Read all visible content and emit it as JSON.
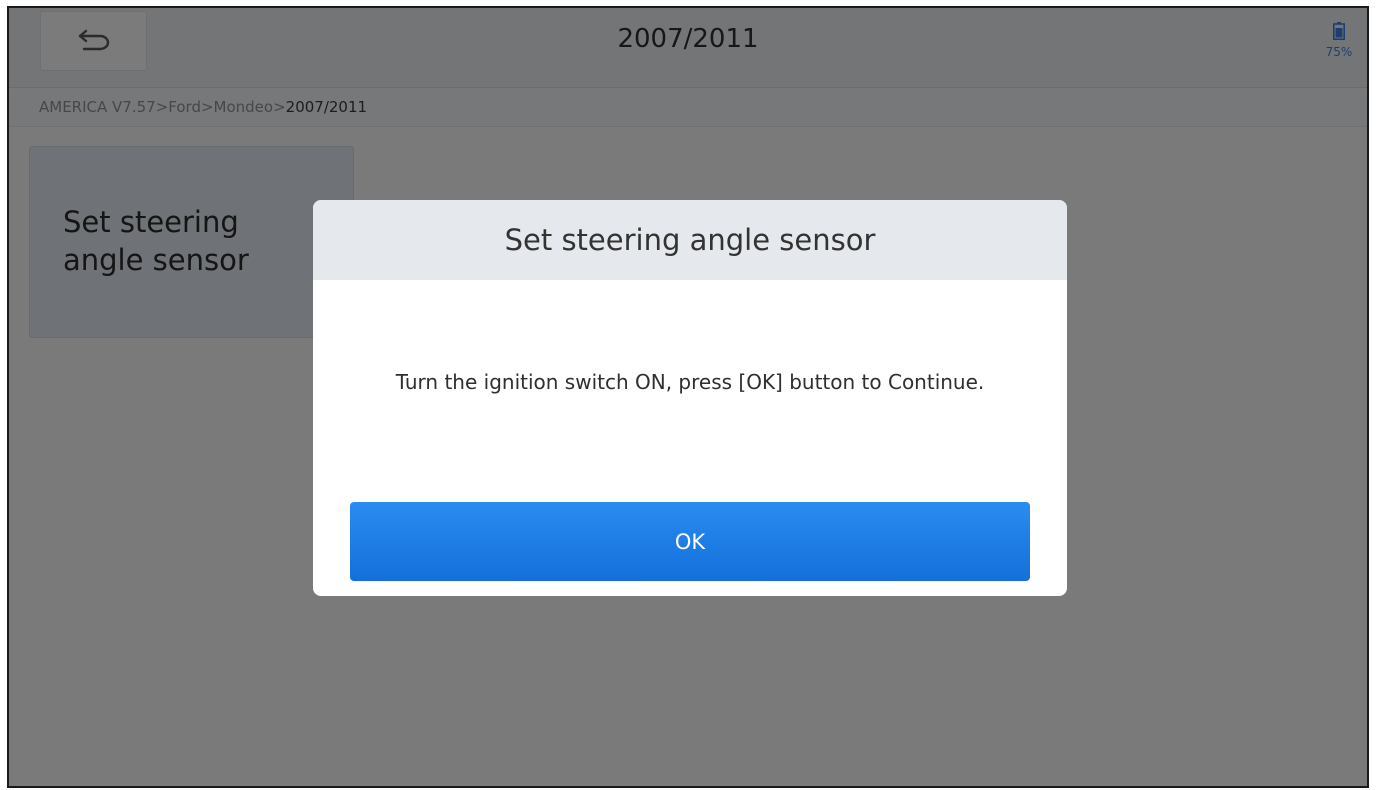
{
  "header": {
    "title": "2007/2011",
    "back_icon": "back-arrow-icon",
    "battery_icon": "battery-icon",
    "battery_level": "75%"
  },
  "breadcrumb": {
    "items": [
      "AMERICA V7.57>",
      "Ford>",
      "Mondeo>",
      "2007/2011"
    ]
  },
  "tiles": [
    {
      "line1": "Set steering",
      "line2": "angle sensor"
    }
  ],
  "dialog": {
    "title": "Set steering angle sensor",
    "message": "Turn the ignition switch ON, press [OK] button to Continue.",
    "ok_label": "OK"
  },
  "colors": {
    "accent": "#1c7ee6",
    "battery": "#3d7edb"
  }
}
